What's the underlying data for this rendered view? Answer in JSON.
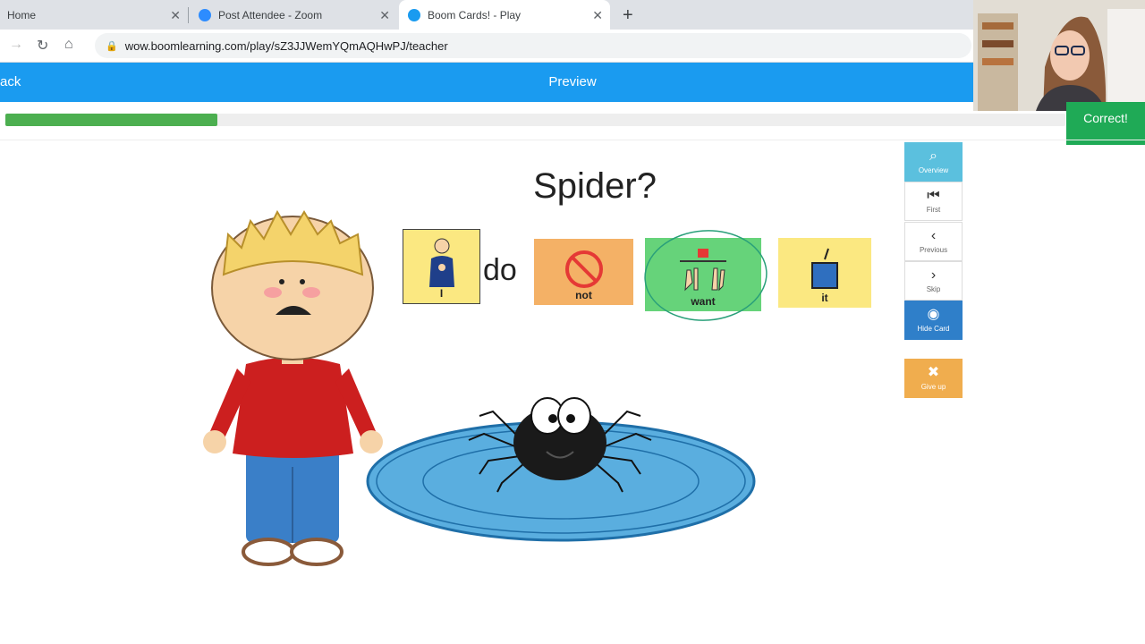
{
  "browser": {
    "tabs": [
      {
        "label": "Home"
      },
      {
        "label": "Post Attendee - Zoom"
      },
      {
        "label": "Boom Cards! - Play"
      }
    ],
    "url": "wow.boomlearning.com/play/sZ3JJWemYQmAQHwPJ/teacher"
  },
  "header": {
    "back_label": "ack",
    "center_title": "Preview",
    "correct_label": "Correct!"
  },
  "progress": {
    "fraction": 0.2
  },
  "card": {
    "question": "Spider?",
    "words": {
      "i": "I",
      "do": "do",
      "not": "not",
      "want": "want",
      "it": "it"
    }
  },
  "sidebar": {
    "overview": "Overview",
    "first": "First",
    "previous": "Previous",
    "skip": "Skip",
    "hide_card": "Hide Card",
    "give_up": "Give up"
  },
  "colors": {
    "header_blue": "#1a9bf0",
    "progress_green": "#4caf50",
    "correct_green": "#1faa56",
    "symbol_yellow": "#fbe881",
    "symbol_orange": "#f4b166",
    "symbol_green": "#66d37a"
  }
}
